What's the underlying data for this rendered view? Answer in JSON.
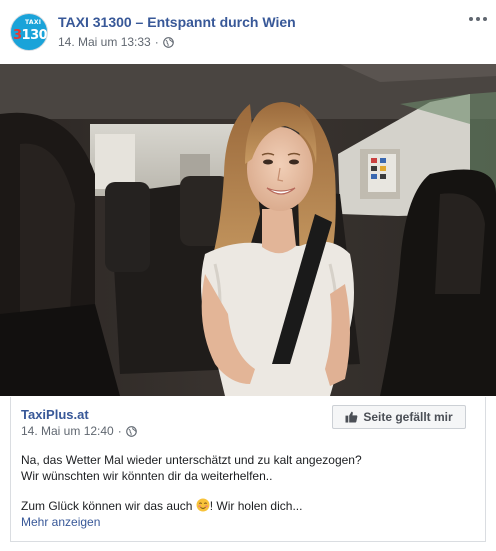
{
  "post": {
    "page_name": "TAXI 31300 – Entspannt durch Wien",
    "timestamp": "14. Mai um 13:33",
    "separator": "·",
    "avatar": {
      "word": "TAXI",
      "num_red": "3",
      "num_rest": "1300"
    },
    "more_icon": "ellipsis-icon",
    "privacy_icon": "globe-icon"
  },
  "shared_post": {
    "page_name": "TaxiPlus.at",
    "timestamp": "14. Mai um 12:40",
    "separator": "·",
    "like_button": "Seite gefällt mir",
    "line1": "Na, das Wetter Mal wieder unterschätzt und zu kalt angezogen?",
    "line2": "Wir wünschten wir könnten dir da weiterhelfen..",
    "line3_before": "Zum Glück können wir das auch ",
    "line3_after": "! Wir holen dich...",
    "see_more": "Mehr anzeigen"
  },
  "colors": {
    "link_blue": "#385898",
    "avatar_blue": "#1aa3d9",
    "secondary_text": "#606770"
  }
}
